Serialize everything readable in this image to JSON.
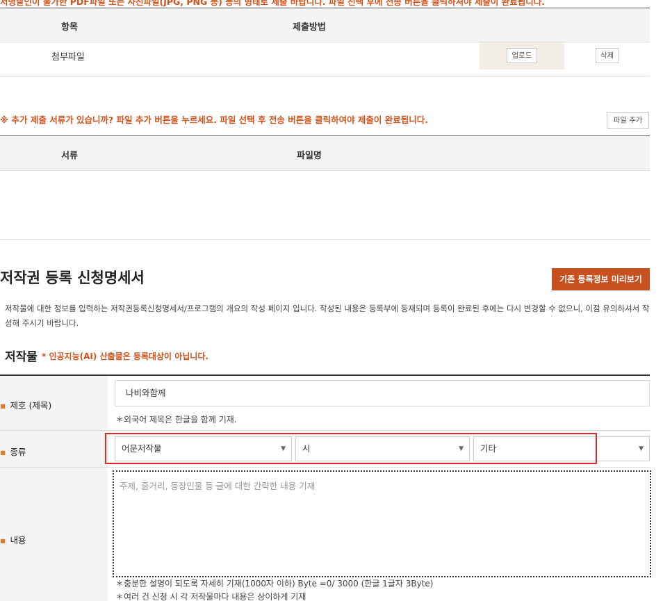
{
  "top_notice": "서명날인이 불가한 PDF파일 또는 사진파일(JPG, PNG 등) 등의 형태로 제출 바랍니다.  파일 선택 후에 전송 버튼을 클릭하셔야 제출이 완료됩니다.",
  "table1": {
    "headers": [
      "항목",
      "제출방법"
    ],
    "row": {
      "label": "첨부파일",
      "upload_label": "업로드",
      "delete_label": "삭제"
    }
  },
  "notice2": "※ 추가 제출 서류가 있습니까? 파일 추가 버튼을 누르세요. 파일 선택 후 전송 버튼을 클릭하여야 제출이 완료됩니다.",
  "add_file_label": "파일 추가",
  "table2": {
    "headers": [
      "서류",
      "파일명"
    ]
  },
  "section": {
    "title": "저작권 등록 신청명세서",
    "preview_label": "기존 등록정보 미리보기",
    "description": "저작물에 대한 정보를 입력하는 저작권등록신청명세서/프로그램의 개요의 작성 페이지 입니다. 작성된 내용은 등록부에 등재되며 등록이 완료된 후에는 다시 변경할 수 없으니, 이점 유의하셔서 작성해 주시기 바랍니다."
  },
  "work": {
    "title": "저작물",
    "note": "* 인공지능(AI) 산출물은 등록대상이 아닙니다.",
    "title_row": {
      "label": "제호 (제목)",
      "value": "나비와함께",
      "hint": "＊외국어 제목은 한글을 함께 기재."
    },
    "type_row": {
      "label": "종류",
      "select1": "어문저작물",
      "select2": "시",
      "select3": "기타",
      "select4": ""
    },
    "content_row": {
      "label": "내용",
      "placeholder": "주제, 줄거리, 등장인물 등 글에 대한 간략한 내용 기재",
      "hint1": "＊충분한 설명이 되도록 자세히 기재(1000자 이하) Byte =0/ 3000 (한글 1글자 3Byte)",
      "hint2": "＊여러 건 신청 시 각 저작물마다 내용은 상이하게 기재"
    }
  },
  "colors": {
    "accent": "#d2531c",
    "button": "#c8501f",
    "highlight_box": "#e0262b",
    "bullet": "#e07b2c"
  },
  "icons": {
    "dropdown": "caret-down-icon"
  }
}
